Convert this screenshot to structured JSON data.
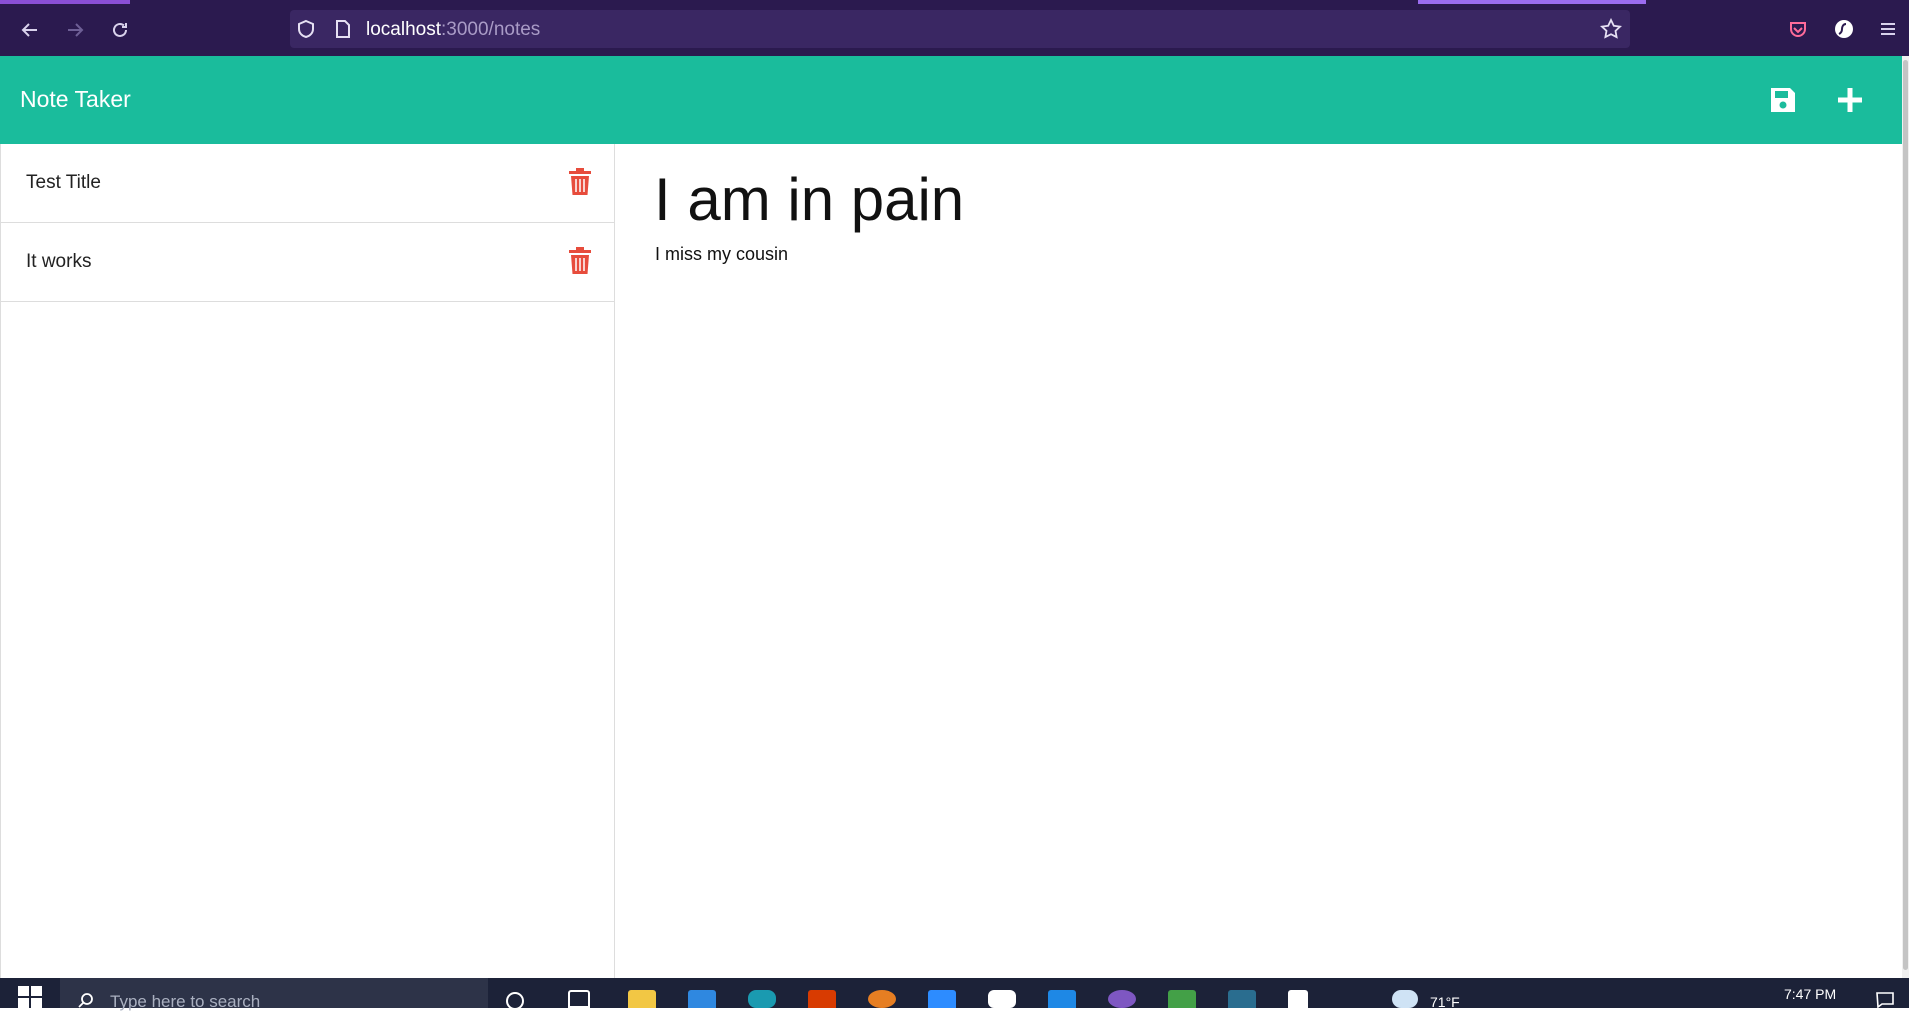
{
  "browser": {
    "url_host": "localhost",
    "url_path": ":3000/notes"
  },
  "app": {
    "title": "Note Taker",
    "header_color": "#1abc9c",
    "icons": {
      "save": "save-icon",
      "new": "plus-icon",
      "delete": "trash-icon"
    },
    "delete_color": "#e74c3c"
  },
  "sidebar": {
    "notes": [
      {
        "title": "Test Title"
      },
      {
        "title": "It works"
      }
    ]
  },
  "editor": {
    "title_value": "I am in pain",
    "body_value": "I miss my cousin"
  },
  "taskbar": {
    "search_placeholder": "Type here to search",
    "weather": "71°F",
    "time": "7:47 PM"
  }
}
